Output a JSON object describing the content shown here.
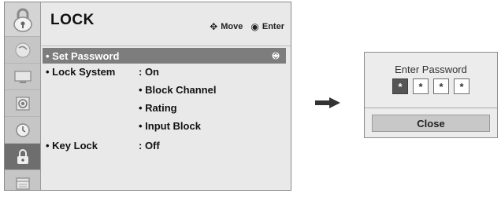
{
  "menu": {
    "title": "LOCK",
    "hint_move": "Move",
    "hint_enter": "Enter",
    "sidebar_icons": [
      "lock-large-icon",
      "satellite-dish-icon",
      "monitor-icon",
      "speaker-icon",
      "clock-icon",
      "lock-icon",
      "calendar-icon"
    ],
    "rows": [
      {
        "label": "• Set Password",
        "value": ""
      },
      {
        "label": "• Lock System",
        "value": ": On"
      },
      {
        "label": "• Key Lock",
        "value": ": Off"
      }
    ],
    "lock_system_options": [
      "• Block Channel",
      "• Rating",
      "• Input Block"
    ]
  },
  "dialog": {
    "title": "Enter Password",
    "digits": [
      "*",
      "*",
      "*",
      "*"
    ],
    "close_label": "Close"
  },
  "colors": {
    "selected_row": "#7d7d7d",
    "sidebar": "#c6c6c6",
    "panel": "#e9e9e9",
    "arrow": "#333333"
  }
}
